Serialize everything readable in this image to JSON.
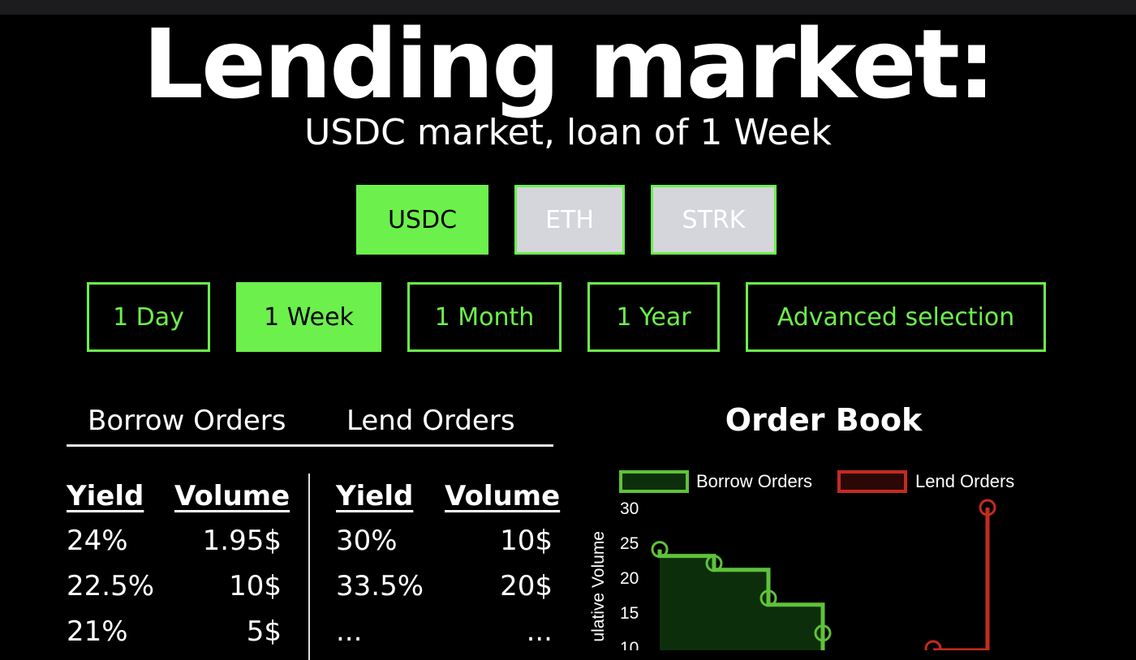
{
  "header": {
    "title": "Lending market:",
    "subtitle": "USDC market, loan of 1 Week"
  },
  "assets": [
    {
      "label": "USDC",
      "active": true
    },
    {
      "label": "ETH",
      "active": false
    },
    {
      "label": "STRK",
      "active": false
    }
  ],
  "durations": [
    {
      "label": "1 Day",
      "active": false
    },
    {
      "label": "1 Week",
      "active": true
    },
    {
      "label": "1 Month",
      "active": false
    },
    {
      "label": "1 Year",
      "active": false
    },
    {
      "label": "Advanced selection",
      "active": false
    }
  ],
  "tabs": {
    "borrow": "Borrow Orders",
    "lend": "Lend Orders"
  },
  "borrow_table": {
    "headers": [
      "Yield",
      "Volume"
    ],
    "rows": [
      [
        "24%",
        "1.95$"
      ],
      [
        "22.5%",
        "10$"
      ],
      [
        "21%",
        "5$"
      ]
    ]
  },
  "lend_table": {
    "headers": [
      "Yield",
      "Volume"
    ],
    "rows": [
      [
        "30%",
        "10$"
      ],
      [
        "33.5%",
        "20$"
      ],
      [
        "...",
        "..."
      ]
    ]
  },
  "order_book": {
    "title": "Order Book",
    "colors": {
      "borrow": "#5fc23a",
      "borrow_fill": "#0d2e0b",
      "lend": "#c42b20",
      "lend_fill": "#2a0806"
    }
  },
  "chart_data": {
    "type": "area",
    "title": "Order Book",
    "ylabel": "ulative Volume",
    "yticks": [
      30,
      25,
      20,
      15,
      10
    ],
    "legend": [
      "Borrow Orders",
      "Lend Orders"
    ],
    "legend_position": "top",
    "series": [
      {
        "name": "Borrow Orders",
        "step": true,
        "x": [
          1,
          2,
          3,
          4
        ],
        "y": [
          24,
          22,
          17,
          12
        ]
      },
      {
        "name": "Lend Orders",
        "step": true,
        "x": [
          7,
          8
        ],
        "y": [
          10,
          30
        ]
      }
    ]
  }
}
